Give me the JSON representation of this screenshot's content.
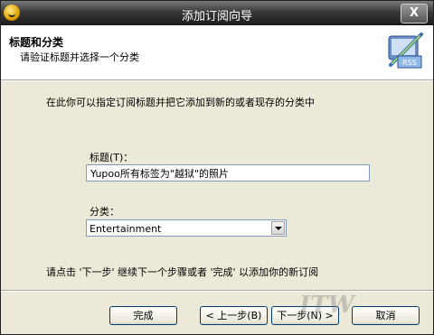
{
  "window": {
    "title": "添加订阅向导",
    "close_label": "X"
  },
  "header": {
    "title": "标题和分类",
    "subtitle": "请验证标题并选择一个分类",
    "logo_text": "RSS"
  },
  "body": {
    "intro": "在此你可以指定订阅标题并把它添加到新的或者现存的分类中",
    "title_label": "标题(T)：",
    "title_value": "Yupoo所有标签为\"越狱\"的照片",
    "category_label": "分类：",
    "category_value": "Entertainment",
    "hint": "请点击 '下一步' 继续下一个步骤或者 '完成' 以添加你的新订阅"
  },
  "buttons": {
    "finish": "完成",
    "back": "< 上一步(B)",
    "next": "下一步(N) >",
    "cancel": "取消"
  },
  "watermark": "ITW"
}
